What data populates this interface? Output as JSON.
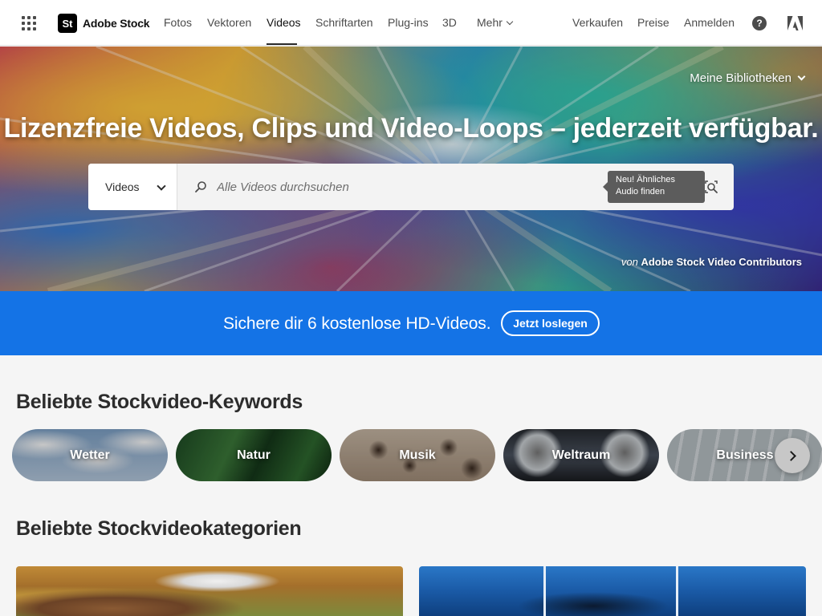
{
  "topnav": {
    "brand_logo": "St",
    "brand_name": "Adobe Stock",
    "items": [
      {
        "label": "Fotos"
      },
      {
        "label": "Vektoren"
      },
      {
        "label": "Videos"
      },
      {
        "label": "Schriftarten"
      },
      {
        "label": "Plug-ins"
      },
      {
        "label": "3D"
      },
      {
        "label": "Mehr"
      }
    ],
    "active": "Videos",
    "right_items": [
      {
        "label": "Verkaufen"
      },
      {
        "label": "Preise"
      },
      {
        "label": "Anmelden"
      }
    ],
    "icons": [
      "apps-grid-icon",
      "help-icon",
      "adobe-logo-icon"
    ]
  },
  "hero": {
    "libraries_label": "Meine Bibliotheken",
    "title": "Lizenzfreie Videos, Clips und Video-Loops – jederzeit verfügbar.",
    "search": {
      "type_label": "Videos",
      "placeholder": "Alle Videos durchsuchen",
      "value": "",
      "tooltip_line1": "Neu! Ähnliches",
      "tooltip_line2": "Audio finden"
    },
    "credit_prefix": "von",
    "credit_name": "Adobe Stock Video Contributors"
  },
  "promo": {
    "text": "Sichere dir 6 kostenlose HD-Videos.",
    "cta": "Jetzt loslegen",
    "background": "#1473e6"
  },
  "keywords": {
    "title": "Beliebte Stockvideo-Keywords",
    "items": [
      {
        "label": "Wetter"
      },
      {
        "label": "Natur"
      },
      {
        "label": "Musik"
      },
      {
        "label": "Weltraum"
      },
      {
        "label": "Business"
      }
    ]
  },
  "categories": {
    "title": "Beliebte Stockvideokategorien"
  }
}
